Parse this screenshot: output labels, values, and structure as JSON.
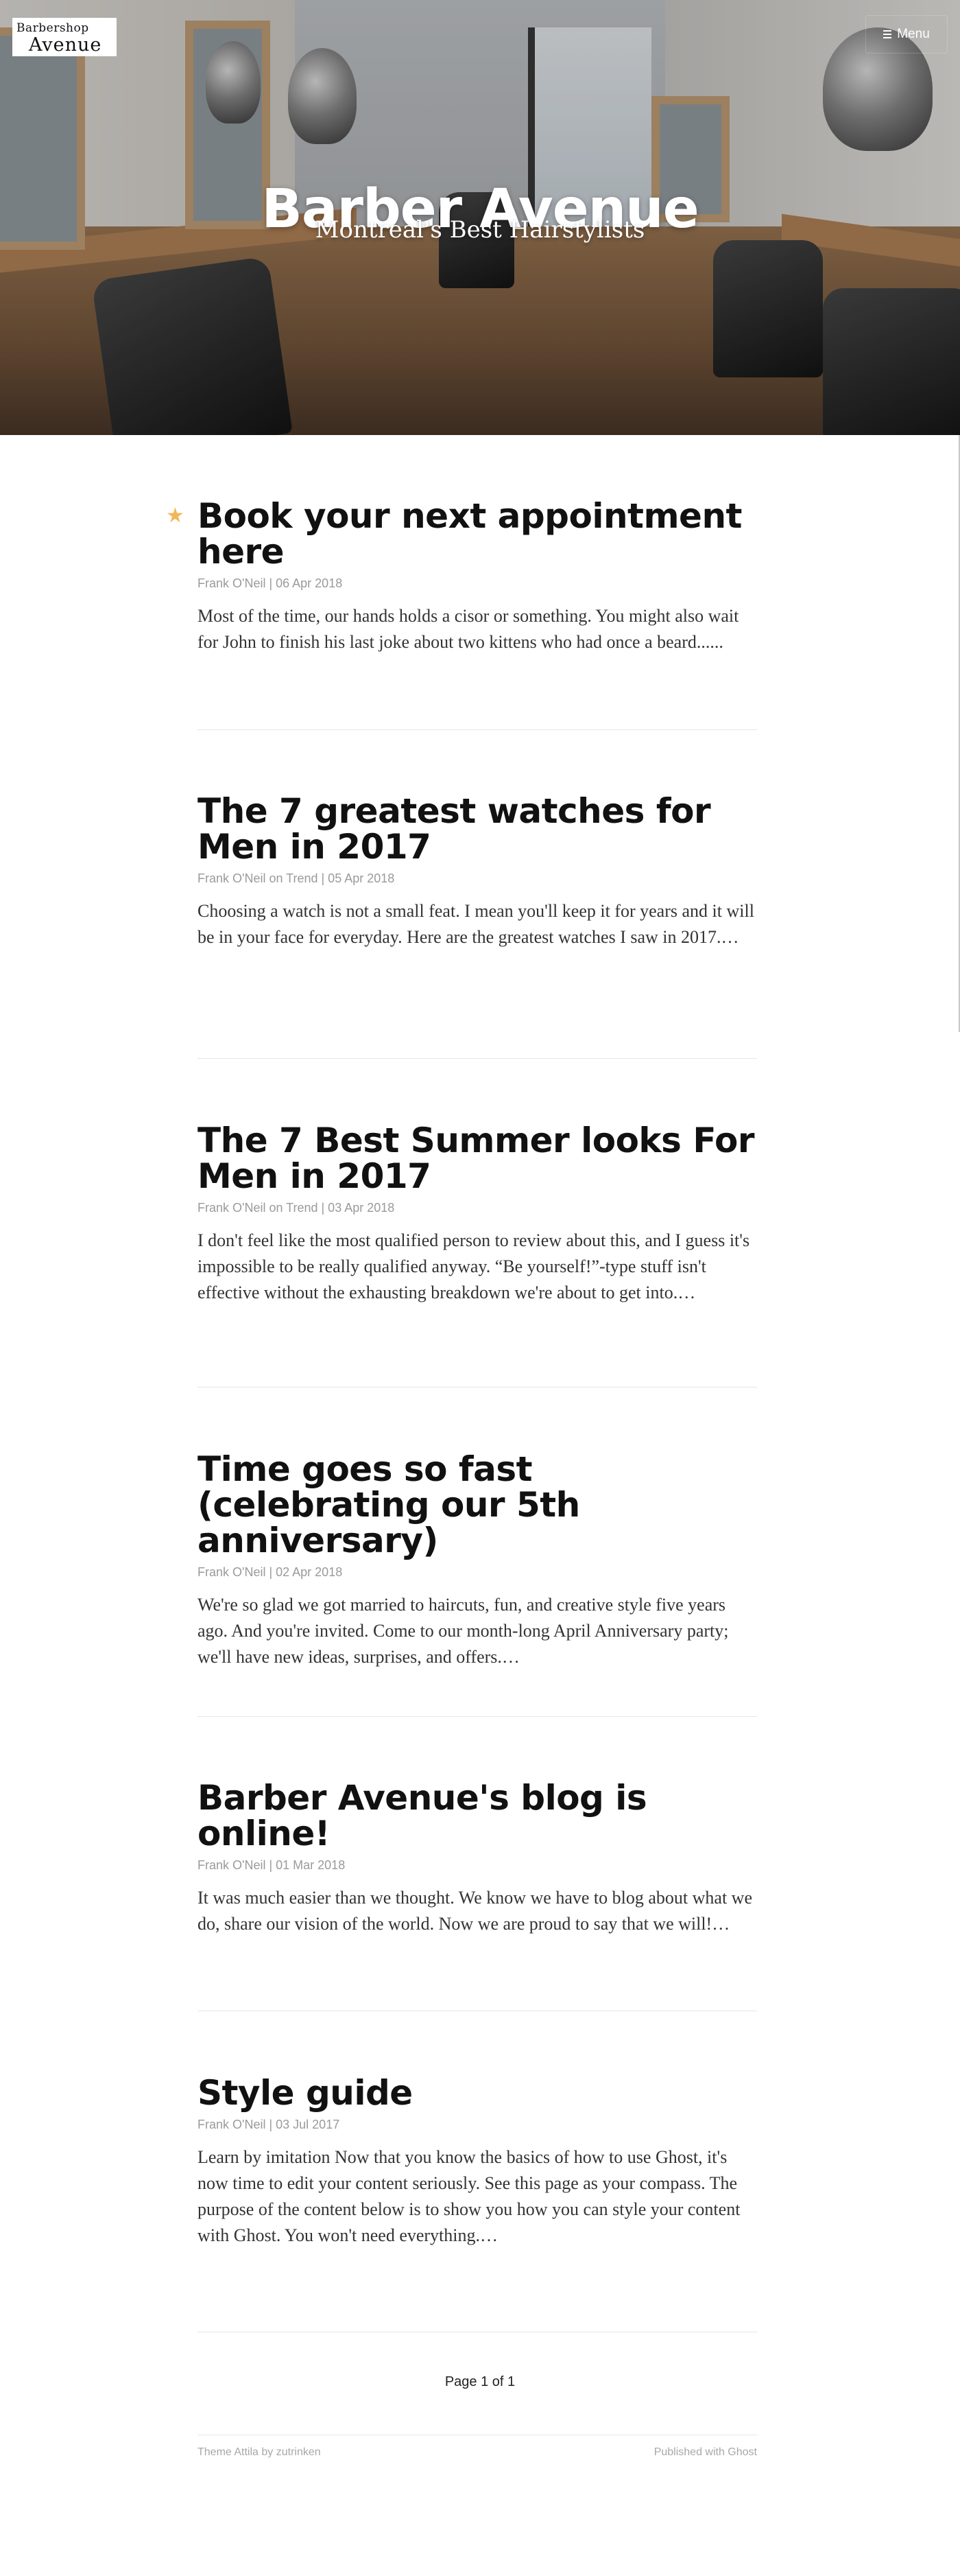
{
  "logo": {
    "line1": "Barbershop",
    "line2": "Avenue"
  },
  "menu": {
    "label": "Menu",
    "icon": "hamburger-icon"
  },
  "hero": {
    "title": "Barber Avenue",
    "subtitle": "Montreal's Best Hairstylists"
  },
  "posts": [
    {
      "title": "Book your next appointment here",
      "meta": "Frank O'Neil | 06 Apr 2018",
      "excerpt": "Most of the time, our hands holds a cisor or something. You might also wait for John to finish his last joke about two kittens who had once a beard......",
      "featured": true
    },
    {
      "title": "The 7 greatest watches for Men in 2017",
      "meta": "Frank O'Neil on Trend | 05 Apr 2018",
      "excerpt": "Choosing a watch is not a small feat. I mean you'll keep it for years and it will be in your face for everyday. Here are the greatest watches I saw in 2017.…",
      "featured": false
    },
    {
      "title": "The 7 Best Summer looks For Men in 2017",
      "meta": "Frank O'Neil on Trend | 03 Apr 2018",
      "excerpt": "I don't feel like the most qualified person to review about this, and I guess it's impossible to be really qualified anyway. “Be yourself!”-type stuff isn't effective without the exhausting breakdown we're about to get into.…",
      "featured": false
    },
    {
      "title": "Time goes so fast (celebrating our 5th anniversary)",
      "meta": "Frank O'Neil | 02 Apr 2018",
      "excerpt": "We're so glad we got married to haircuts, fun, and creative style five years ago. And you're invited. Come to our month-long April Anniversary party; we'll have new ideas, surprises, and offers.…",
      "featured": false
    },
    {
      "title": "Barber Avenue's blog is online!",
      "meta": "Frank O'Neil | 01 Mar 2018",
      "excerpt": "It was much easier than we thought. We know we have to blog about what we do, share our vision of the world. Now we are proud to say that we will!…",
      "featured": false
    },
    {
      "title": "Style guide",
      "meta": "Frank O'Neil | 03 Jul 2017",
      "excerpt": "Learn by imitation Now that you know the basics of how to use Ghost, it's now time to edit your content seriously. See this page as your compass. The purpose of the content below is to show you how you can style your content with Ghost. You won't need everything.…",
      "featured": false
    }
  ],
  "pagination": {
    "label": "Page 1 of 1"
  },
  "footer": {
    "left": "Theme Attila by zutrinken",
    "right": "Published with Ghost"
  },
  "colors": {
    "star": "#f0b85a",
    "title": "#111111",
    "meta": "#9a9a9a"
  }
}
